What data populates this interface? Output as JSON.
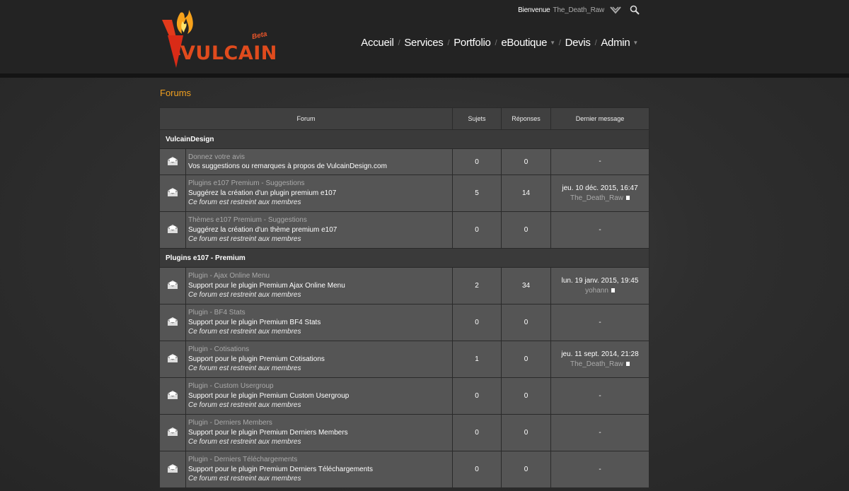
{
  "brand": {
    "name": "VULCAIN",
    "badge": "Beta"
  },
  "userbar": {
    "greeting": "Bienvenue",
    "username": "The_Death_Raw"
  },
  "nav": [
    {
      "label": "Accueil",
      "dropdown": false
    },
    {
      "label": "Services",
      "dropdown": false
    },
    {
      "label": "Portfolio",
      "dropdown": false
    },
    {
      "label": "eBoutique",
      "dropdown": true
    },
    {
      "label": "Devis",
      "dropdown": false
    },
    {
      "label": "Admin",
      "dropdown": true
    }
  ],
  "breadcrumb": "Forums",
  "table": {
    "headers": {
      "forum": "Forum",
      "topics": "Sujets",
      "replies": "Réponses",
      "last": "Dernier message"
    },
    "restricted_text": "Ce forum est restreint aux membres",
    "categories": [
      {
        "name": "VulcainDesign",
        "forums": [
          {
            "title": "Donnez votre avis",
            "desc": "Vos suggestions ou remarques à propos de VulcainDesign.com",
            "restricted": false,
            "topics": "0",
            "replies": "0",
            "last_date": "-",
            "last_user": ""
          },
          {
            "title": "Plugins e107 Premium - Suggestions",
            "desc": "Suggérez la création d'un plugin premium e107",
            "restricted": true,
            "topics": "5",
            "replies": "14",
            "last_date": "jeu. 10 déc. 2015, 16:47",
            "last_user": "The_Death_Raw"
          },
          {
            "title": "Thèmes e107 Premium - Suggestions",
            "desc": "Suggérez la création d'un thème premium e107",
            "restricted": true,
            "topics": "0",
            "replies": "0",
            "last_date": "-",
            "last_user": ""
          }
        ]
      },
      {
        "name": "Plugins e107 - Premium",
        "forums": [
          {
            "title": "Plugin - Ajax Online Menu",
            "desc": "Support pour le plugin Premium Ajax Online Menu",
            "restricted": true,
            "topics": "2",
            "replies": "34",
            "last_date": "lun. 19 janv. 2015, 19:45",
            "last_user": "yohann"
          },
          {
            "title": "Plugin - BF4 Stats",
            "desc": "Support pour le plugin Premium BF4 Stats",
            "restricted": true,
            "topics": "0",
            "replies": "0",
            "last_date": "-",
            "last_user": ""
          },
          {
            "title": "Plugin - Cotisations",
            "desc": "Support pour le plugin Premium Cotisations",
            "restricted": true,
            "topics": "1",
            "replies": "0",
            "last_date": "jeu. 11 sept. 2014, 21:28",
            "last_user": "The_Death_Raw"
          },
          {
            "title": "Plugin - Custom Usergroup",
            "desc": "Support pour le plugin Premium Custom Usergroup",
            "restricted": true,
            "topics": "0",
            "replies": "0",
            "last_date": "-",
            "last_user": ""
          },
          {
            "title": "Plugin - Derniers Members",
            "desc": "Support pour le plugin Premium Derniers Members",
            "restricted": true,
            "topics": "0",
            "replies": "0",
            "last_date": "-",
            "last_user": ""
          },
          {
            "title": "Plugin - Derniers Téléchargements",
            "desc": "Support pour le plugin Premium Derniers Téléchargements",
            "restricted": true,
            "topics": "0",
            "replies": "0",
            "last_date": "-",
            "last_user": ""
          }
        ]
      }
    ]
  }
}
